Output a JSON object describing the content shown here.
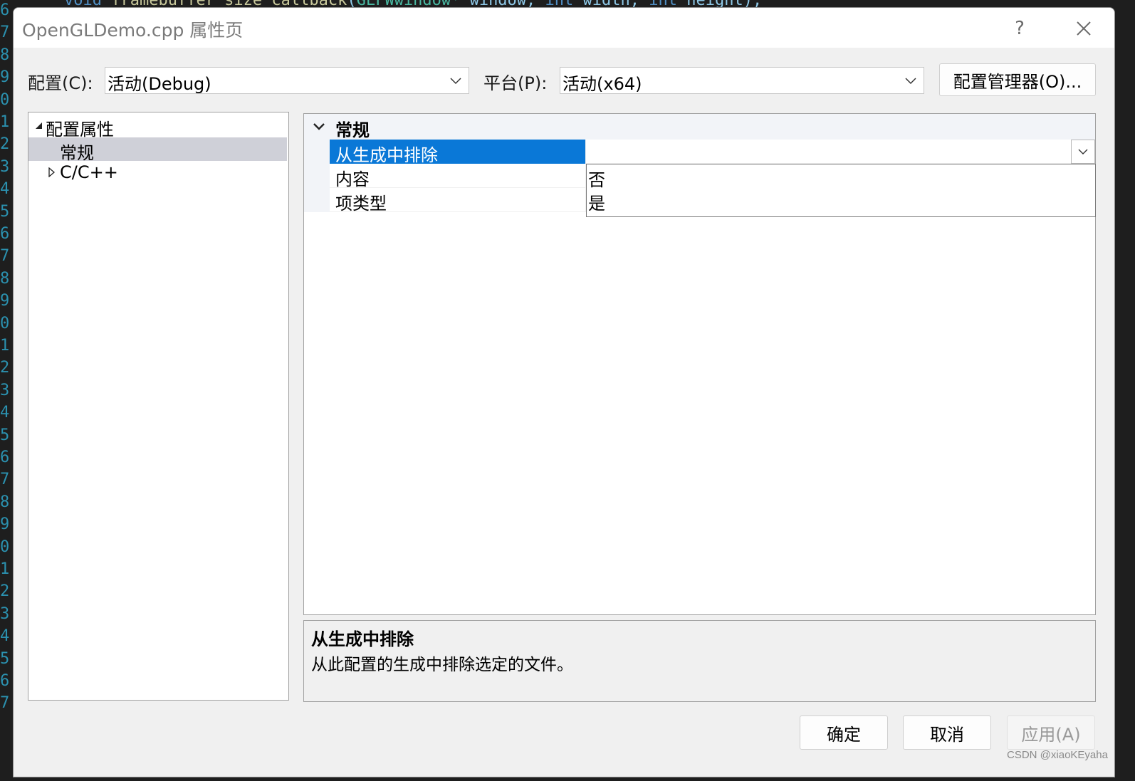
{
  "background_editor": {
    "line_numbers": [
      "6",
      "7",
      "8",
      "9",
      "0",
      "1",
      "2",
      "3",
      "4",
      "5",
      "6",
      "7",
      "8",
      "9",
      "0",
      "1",
      "2",
      "3",
      "4",
      "5",
      "6",
      "7",
      "8",
      "9",
      "0",
      "1",
      "2",
      "3",
      "4",
      "5",
      "6",
      "7"
    ],
    "code_fragment": {
      "kw1": "void",
      "fn": "framebuffer_size_callback",
      "ty": "GLFWwindow*",
      "p1": " window, ",
      "kw2": "int",
      "p2": " width, ",
      "kw3": "int",
      "p3": " height);"
    }
  },
  "dialog": {
    "title": "OpenGLDemo.cpp 属性页",
    "help_glyph": "?",
    "close_glyph": "✕"
  },
  "config": {
    "config_label": "配置(C):",
    "config_value": "活动(Debug)",
    "platform_label": "平台(P):",
    "platform_value": "活动(x64)",
    "manager_button": "配置管理器(O)..."
  },
  "tree": {
    "items": [
      {
        "label": "配置属性",
        "expanded": true
      },
      {
        "label": "常规",
        "selected": true
      },
      {
        "label": "C/C++",
        "expanded": false
      }
    ]
  },
  "grid": {
    "category": "常规",
    "rows": [
      {
        "name": "从生成中排除",
        "selected": true
      },
      {
        "name": "内容"
      },
      {
        "name": "项类型"
      }
    ],
    "dropdown_options": [
      "否",
      "是"
    ]
  },
  "description": {
    "title": "从生成中排除",
    "text": "从此配置的生成中排除选定的文件。"
  },
  "footer": {
    "ok": "确定",
    "cancel": "取消",
    "apply": "应用(A)"
  },
  "watermark": "CSDN @xiaoKEyaha",
  "colors": {
    "selection_blue": "#0a78d7",
    "tree_selection": "#cfd0d8",
    "dialog_bg": "#f0f0f0"
  }
}
